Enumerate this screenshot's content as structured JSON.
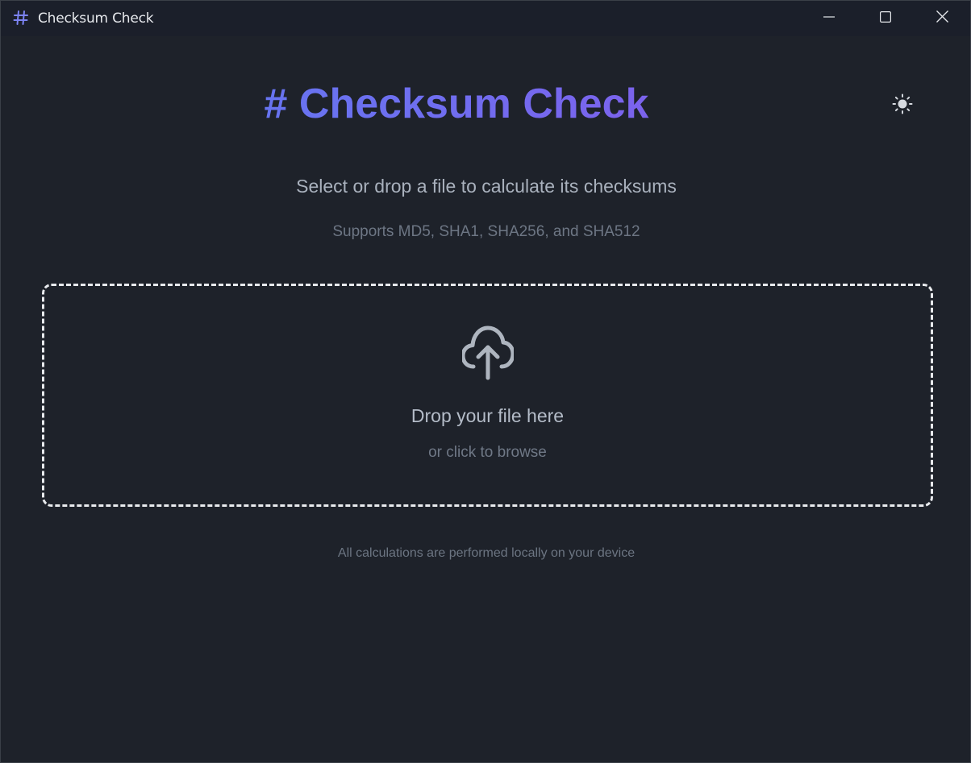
{
  "window": {
    "title": "Checksum Check",
    "app_icon": "hash-icon",
    "controls": {
      "minimize_icon": "minimize-icon",
      "maximize_icon": "maximize-icon",
      "close_icon": "close-icon"
    }
  },
  "header": {
    "title": "# Checksum Check",
    "theme_toggle_icon": "sun-icon",
    "gradient_colors": [
      "#5a7cf0",
      "#8a55e8"
    ]
  },
  "main": {
    "subtitle": "Select or drop a file to calculate its checksums",
    "supported": "Supports MD5, SHA1, SHA256, and SHA512"
  },
  "dropzone": {
    "icon": "cloud-upload-icon",
    "title": "Drop your file here",
    "subtitle": "or click to browse"
  },
  "footer": {
    "note": "All calculations are performed locally on your device"
  },
  "colors": {
    "background": "#1e222a",
    "titlebar": "#1b1f2a",
    "dropzone_border": "#e8eaed",
    "accent": "#6e6ff0"
  }
}
